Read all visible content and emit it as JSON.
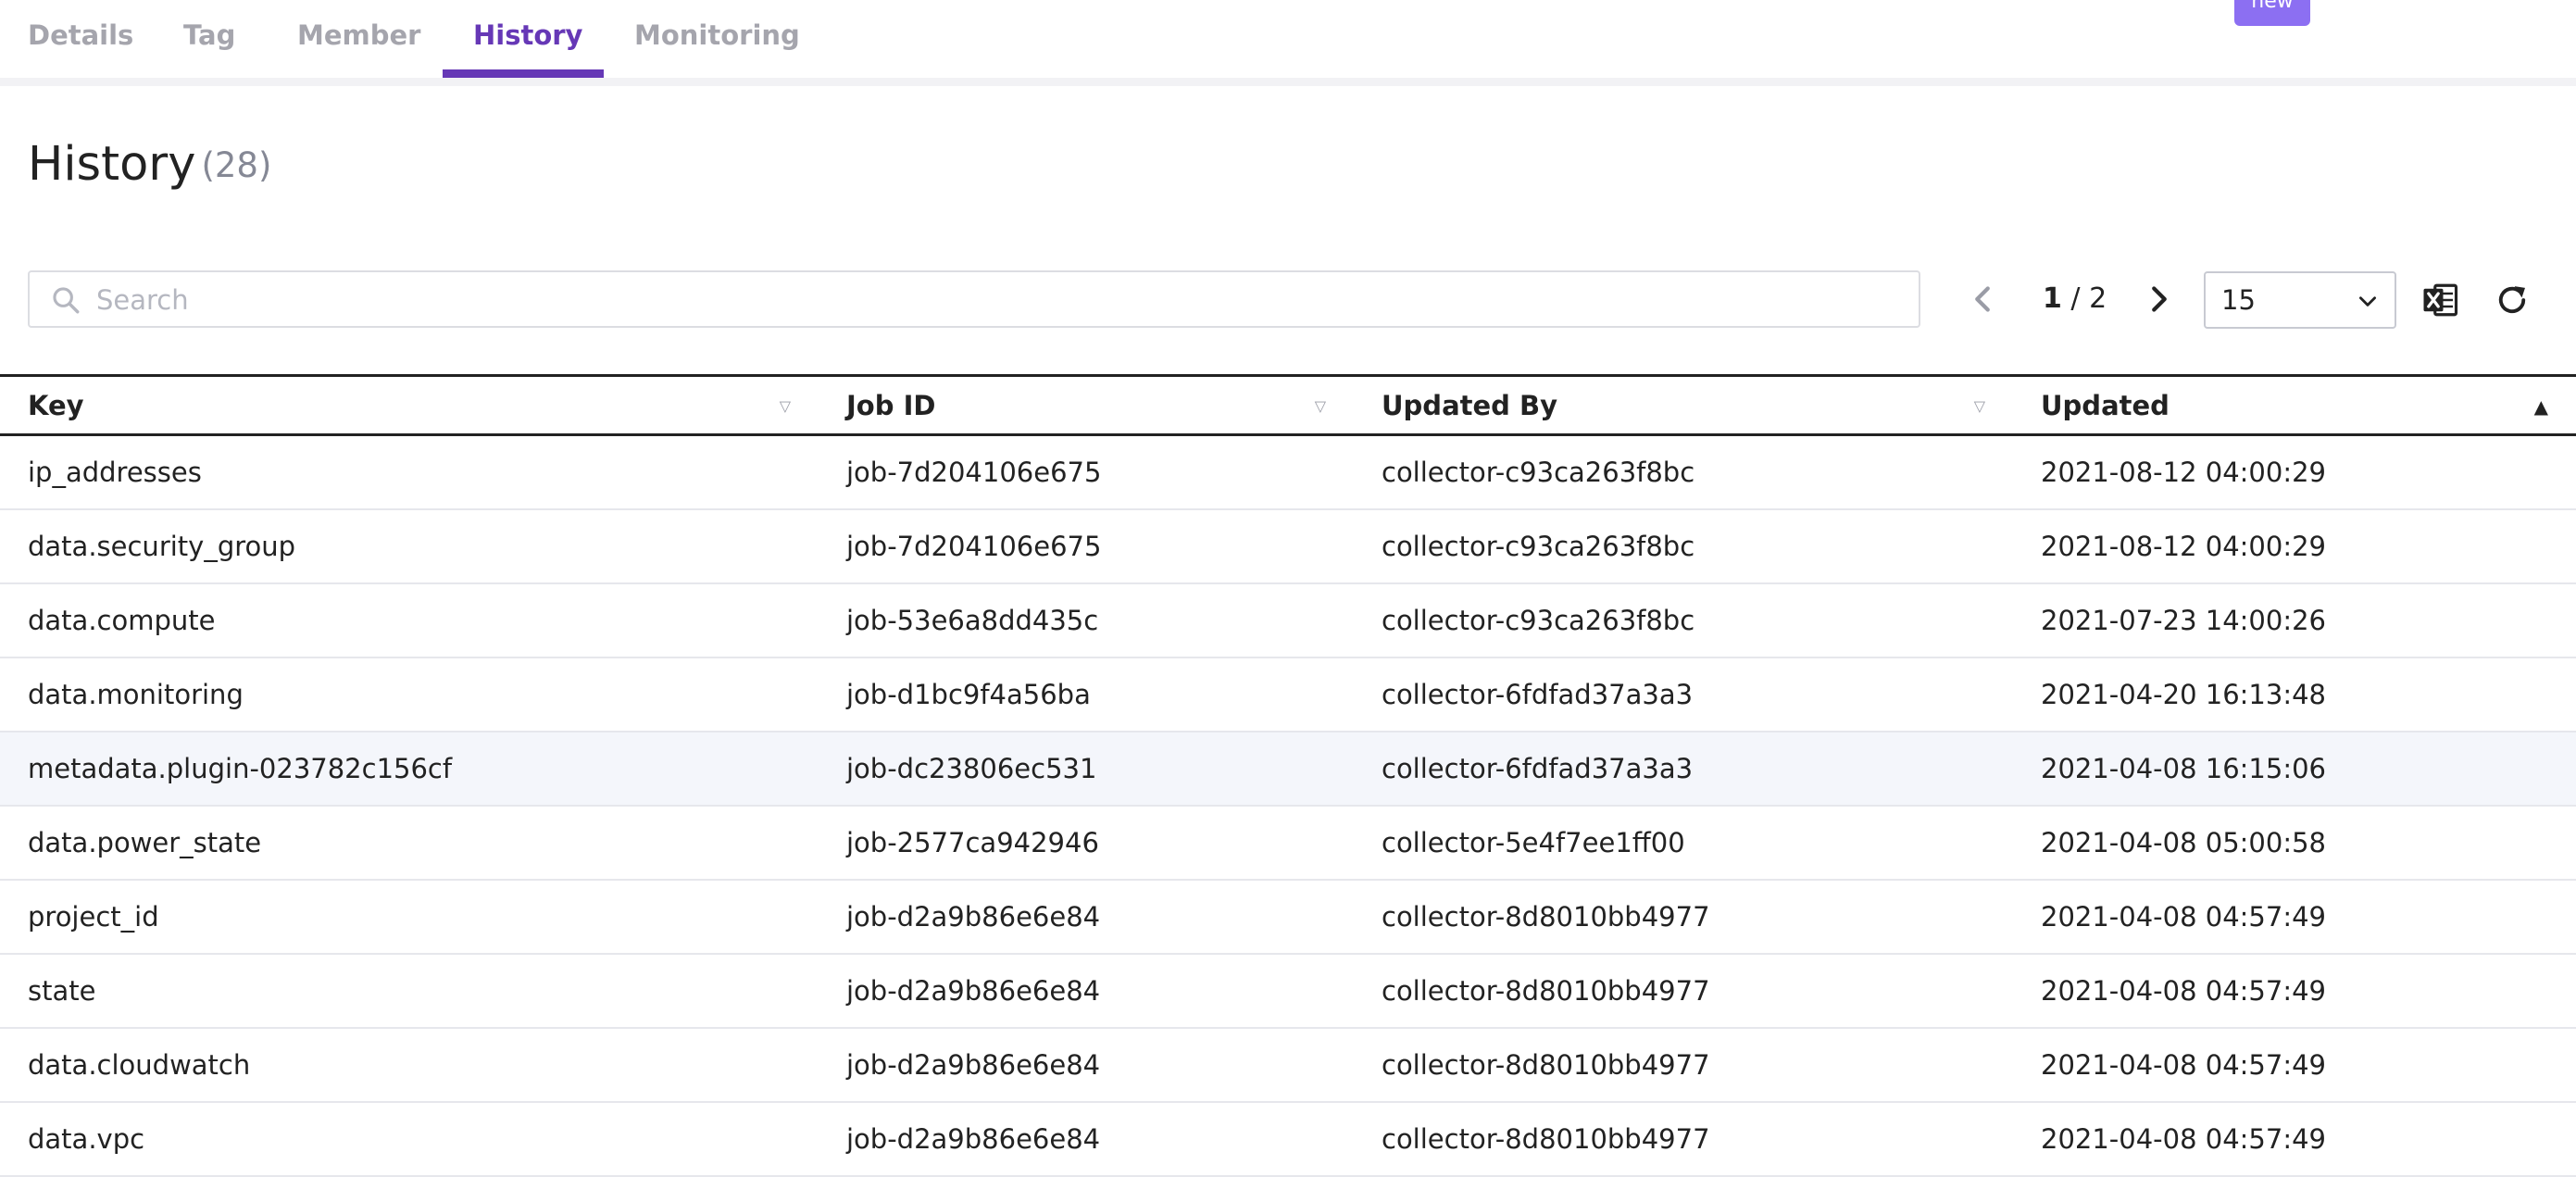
{
  "tabs": [
    {
      "label": "Details"
    },
    {
      "label": "Tag"
    },
    {
      "label": "Member"
    },
    {
      "label": "History"
    },
    {
      "label": "Monitoring"
    }
  ],
  "active_tab": "History",
  "new_badge": "new",
  "header": {
    "title": "History",
    "count": "(28)"
  },
  "search": {
    "placeholder": "Search",
    "value": ""
  },
  "pagination": {
    "current": "1",
    "separator": " / ",
    "total": "2"
  },
  "page_size": {
    "value": "15"
  },
  "icons": {
    "search": "search-icon",
    "prev": "chevron-left-icon",
    "next": "chevron-right-icon",
    "dropdown": "chevron-down-icon",
    "excel": "excel-export-icon",
    "refresh": "refresh-icon"
  },
  "colors": {
    "accent": "#6638b6",
    "badge": "#8c6ff2",
    "excel": "#222222"
  },
  "table": {
    "columns": [
      "Key",
      "Job ID",
      "Updated By",
      "Updated"
    ],
    "sort_column": "Updated",
    "rows": [
      {
        "key": "ip_addresses",
        "job_id": "job-7d204106e675",
        "updated_by": "collector-c93ca263f8bc",
        "updated": "2021-08-12 04:00:29"
      },
      {
        "key": "data.security_group",
        "job_id": "job-7d204106e675",
        "updated_by": "collector-c93ca263f8bc",
        "updated": "2021-08-12 04:00:29"
      },
      {
        "key": "data.compute",
        "job_id": "job-53e6a8dd435c",
        "updated_by": "collector-c93ca263f8bc",
        "updated": "2021-07-23 14:00:26"
      },
      {
        "key": "data.monitoring",
        "job_id": "job-d1bc9f4a56ba",
        "updated_by": "collector-6fdfad37a3a3",
        "updated": "2021-04-20 16:13:48"
      },
      {
        "key": "metadata.plugin-023782c156cf",
        "job_id": "job-dc23806ec531",
        "updated_by": "collector-6fdfad37a3a3",
        "updated": "2021-04-08 16:15:06"
      },
      {
        "key": "data.power_state",
        "job_id": "job-2577ca942946",
        "updated_by": "collector-5e4f7ee1ff00",
        "updated": "2021-04-08 05:00:58"
      },
      {
        "key": "project_id",
        "job_id": "job-d2a9b86e6e84",
        "updated_by": "collector-8d8010bb4977",
        "updated": "2021-04-08 04:57:49"
      },
      {
        "key": "state",
        "job_id": "job-d2a9b86e6e84",
        "updated_by": "collector-8d8010bb4977",
        "updated": "2021-04-08 04:57:49"
      },
      {
        "key": "data.cloudwatch",
        "job_id": "job-d2a9b86e6e84",
        "updated_by": "collector-8d8010bb4977",
        "updated": "2021-04-08 04:57:49"
      },
      {
        "key": "data.vpc",
        "job_id": "job-d2a9b86e6e84",
        "updated_by": "collector-8d8010bb4977",
        "updated": "2021-04-08 04:57:49"
      }
    ]
  }
}
